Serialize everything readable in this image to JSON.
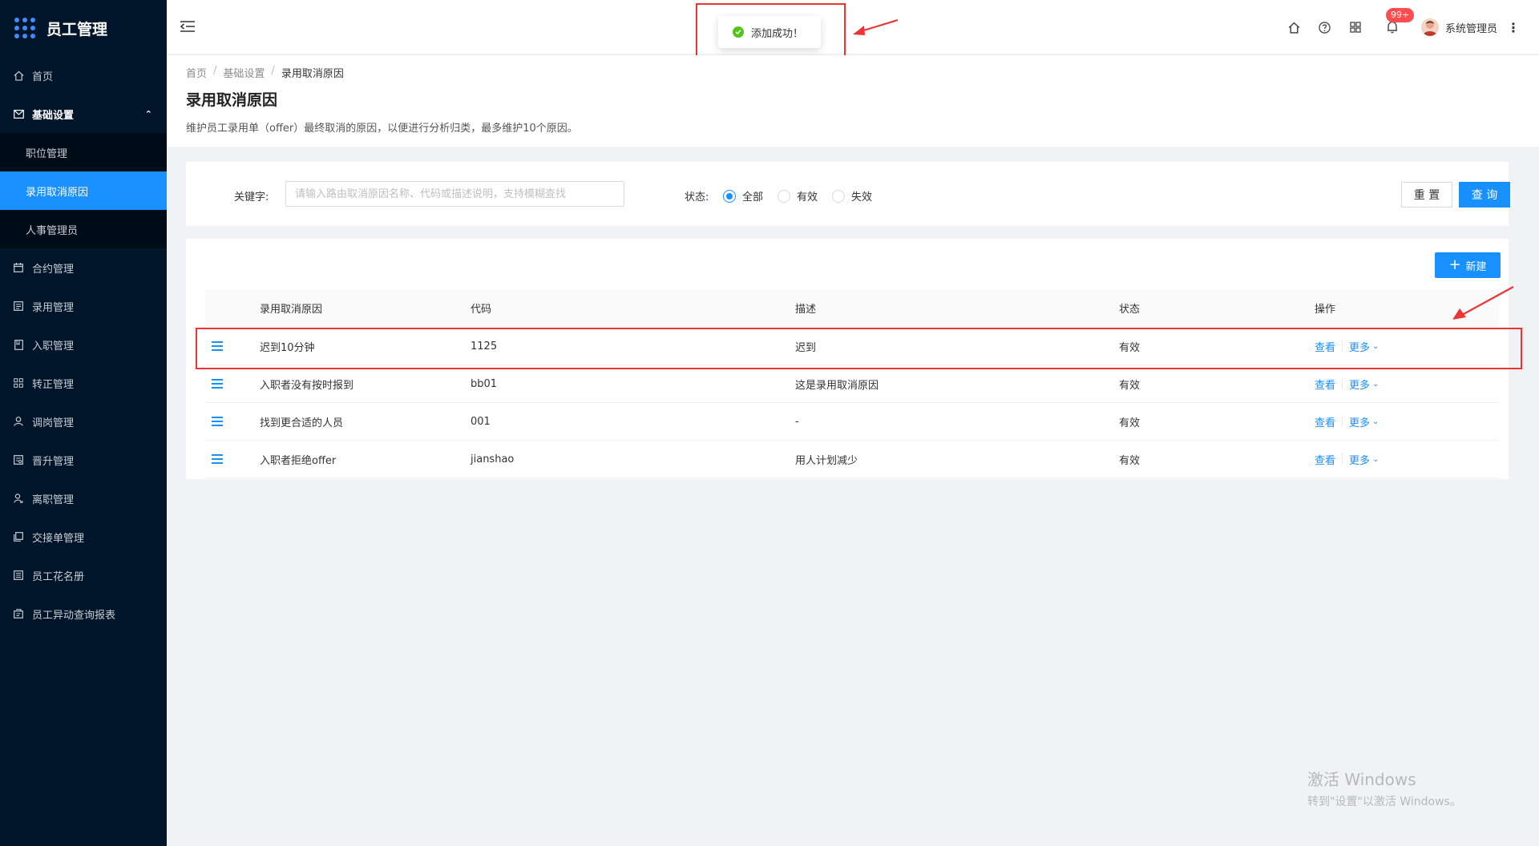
{
  "app": {
    "title": "员工管理"
  },
  "sidebar": {
    "items": [
      {
        "label": "首页"
      },
      {
        "label": "基础设置"
      },
      {
        "label": "职位管理"
      },
      {
        "label": "录用取消原因"
      },
      {
        "label": "人事管理员"
      },
      {
        "label": "合约管理"
      },
      {
        "label": "录用管理"
      },
      {
        "label": "入职管理"
      },
      {
        "label": "转正管理"
      },
      {
        "label": "调岗管理"
      },
      {
        "label": "晋升管理"
      },
      {
        "label": "离职管理"
      },
      {
        "label": "交接单管理"
      },
      {
        "label": "员工花名册"
      },
      {
        "label": "员工异动查询报表"
      }
    ]
  },
  "header": {
    "badge": "99+",
    "user": "系统管理员"
  },
  "toast": {
    "message": "添加成功！"
  },
  "breadcrumb": [
    "首页",
    "基础设置",
    "录用取消原因"
  ],
  "page": {
    "title": "录用取消原因",
    "desc": "维护员工录用单（offer）最终取消的原因，以便进行分析归类，最多维护10个原因。"
  },
  "filter": {
    "keyword_label": "关键字:",
    "keyword_placeholder": "请输入路由取消原因名称、代码或描述说明，支持模糊查找",
    "status_label": "状态:",
    "options": [
      "全部",
      "有效",
      "失效"
    ],
    "selected": "全部",
    "reset": "重 置",
    "query": "查 询"
  },
  "table": {
    "new_button": "新建",
    "columns": [
      "录用取消原因",
      "代码",
      "描述",
      "状态",
      "操作"
    ],
    "rows": [
      {
        "reason": "迟到10分钟",
        "code": "1125",
        "desc": "迟到",
        "status": "有效",
        "view": "查看",
        "more": "更多"
      },
      {
        "reason": "入职者没有按时报到",
        "code": "bb01",
        "desc": "这是录用取消原因",
        "status": "有效",
        "view": "查看",
        "more": "更多"
      },
      {
        "reason": "找到更合适的人员",
        "code": "001",
        "desc": "-",
        "status": "有效",
        "view": "查看",
        "more": "更多"
      },
      {
        "reason": "入职者拒绝offer",
        "code": "jianshao",
        "desc": "用人计划减少",
        "status": "有效",
        "view": "查看",
        "more": "更多"
      }
    ]
  },
  "watermark": {
    "line1": "激活 Windows",
    "line2": "转到\"设置\"以激活 Windows。"
  },
  "colors": {
    "primary": "#1890ff",
    "sidebar": "#001529",
    "highlight": "#e33333"
  }
}
